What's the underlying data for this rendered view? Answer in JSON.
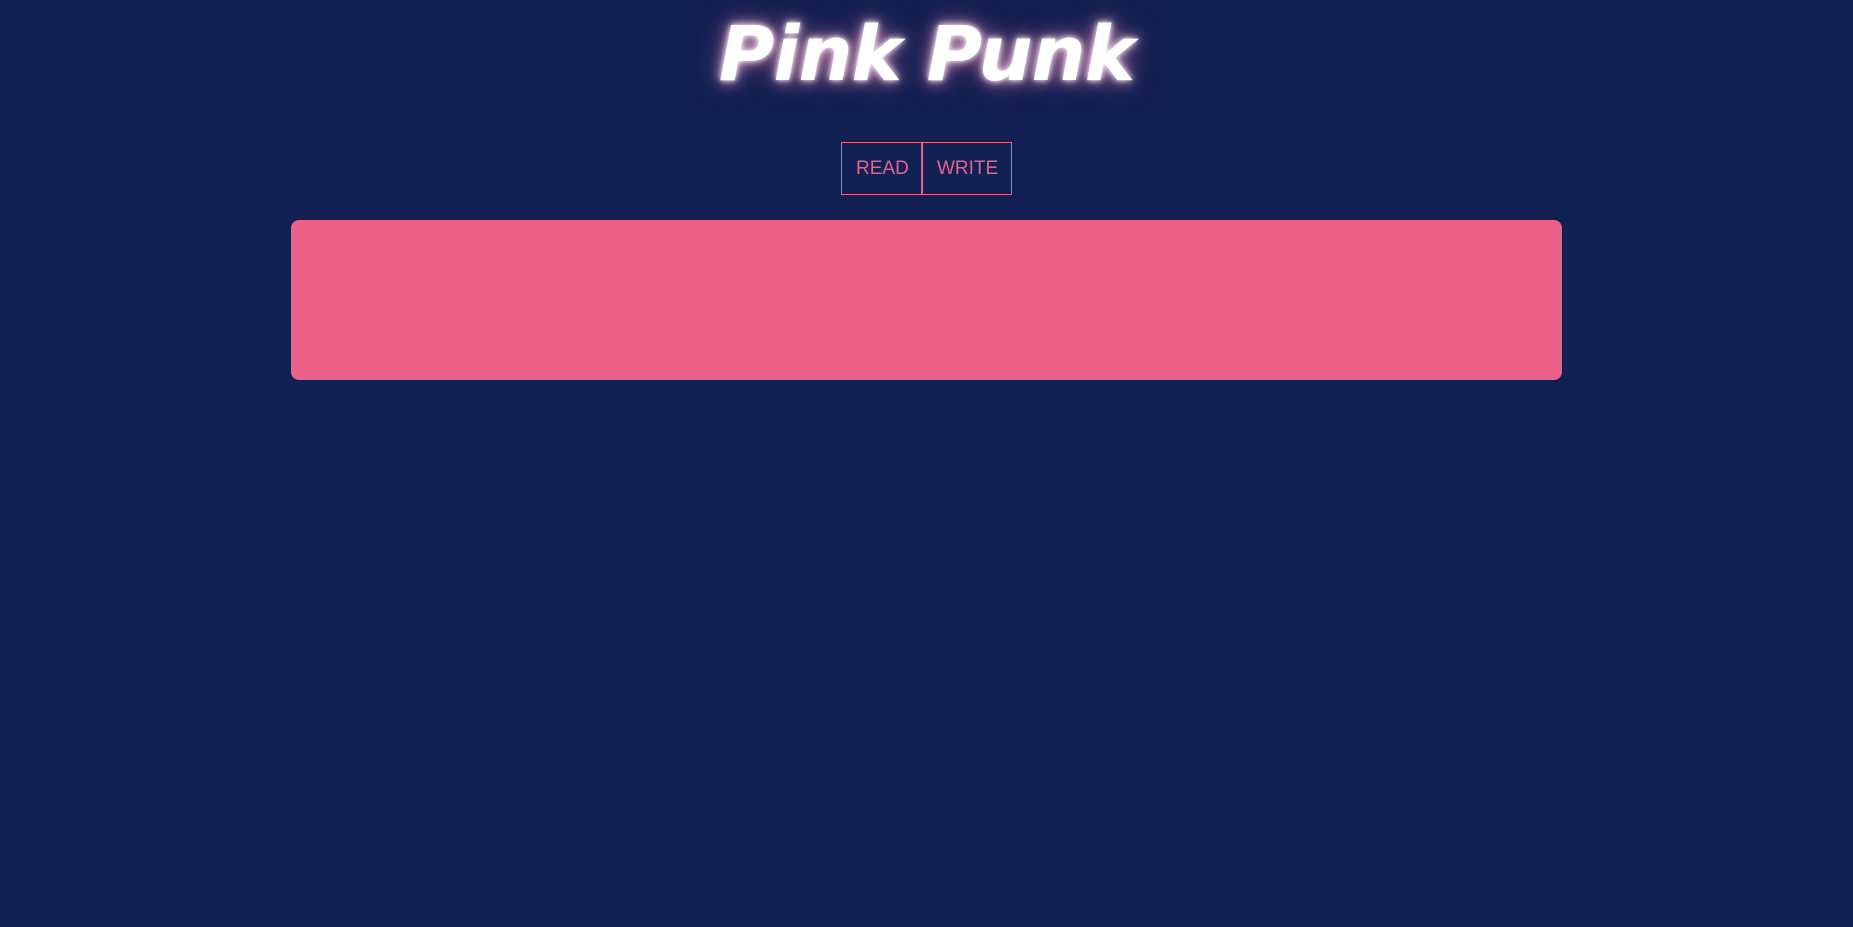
{
  "header": {
    "title": "Pink Punk"
  },
  "nav": {
    "read_label": "READ",
    "write_label": "WRITE"
  },
  "colors": {
    "background": "#132053",
    "accent": "#ec6089",
    "title": "#ffffff"
  }
}
